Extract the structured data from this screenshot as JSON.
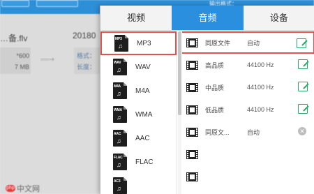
{
  "background": {
    "file_name": "…备.flv",
    "date": "20180",
    "resolution": "*600",
    "size": "7 MB",
    "format_label": "格式：",
    "duration_label": "长度：",
    "top_right_text": "输出格式：",
    "brand": "中文网"
  },
  "tabs": [
    {
      "label": "视频",
      "active": false
    },
    {
      "label": "音频",
      "active": true
    },
    {
      "label": "设备",
      "active": false
    }
  ],
  "formats": [
    {
      "label": "MP3",
      "ext": "MP3",
      "selected": true
    },
    {
      "label": "WAV",
      "ext": "WAV",
      "selected": false
    },
    {
      "label": "M4A",
      "ext": "M4A",
      "selected": false
    },
    {
      "label": "WMA",
      "ext": "WMA",
      "selected": false
    },
    {
      "label": "AAC",
      "ext": "AAC",
      "selected": false
    },
    {
      "label": "FLAC",
      "ext": "FLAC",
      "selected": false
    },
    {
      "label": "",
      "ext": "AC3",
      "selected": false
    }
  ],
  "presets": [
    {
      "name": "同原文件",
      "freq": "自动",
      "action": "edit",
      "selected": true
    },
    {
      "name": "高品质",
      "freq": "44100 Hz",
      "action": "edit",
      "selected": false
    },
    {
      "name": "中品质",
      "freq": "44100 Hz",
      "action": "edit",
      "selected": false
    },
    {
      "name": "低品质",
      "freq": "44100 Hz",
      "action": "edit",
      "selected": false
    },
    {
      "name": "同原文...",
      "freq": "自动",
      "action": "delete",
      "selected": false
    },
    {
      "name": "",
      "freq": "",
      "action": "",
      "selected": false
    },
    {
      "name": "",
      "freq": "",
      "action": "",
      "selected": false
    }
  ],
  "colors": {
    "accent": "#2b8fe0",
    "selection_border": "#e05151",
    "edit_icon": "#2aa86a"
  }
}
